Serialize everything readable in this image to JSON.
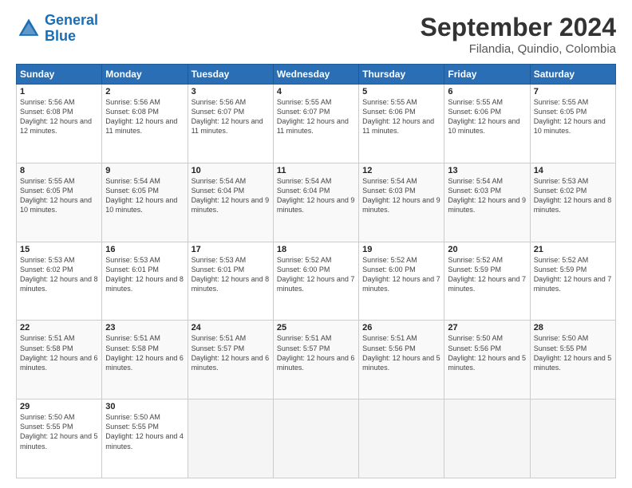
{
  "header": {
    "logo_general": "General",
    "logo_blue": "Blue",
    "month_title": "September 2024",
    "subtitle": "Filandia, Quindio, Colombia"
  },
  "calendar": {
    "days_of_week": [
      "Sunday",
      "Monday",
      "Tuesday",
      "Wednesday",
      "Thursday",
      "Friday",
      "Saturday"
    ],
    "weeks": [
      [
        {
          "day": "1",
          "sunrise": "5:56 AM",
          "sunset": "6:08 PM",
          "daylight": "12 hours and 12 minutes."
        },
        {
          "day": "2",
          "sunrise": "5:56 AM",
          "sunset": "6:08 PM",
          "daylight": "12 hours and 11 minutes."
        },
        {
          "day": "3",
          "sunrise": "5:56 AM",
          "sunset": "6:07 PM",
          "daylight": "12 hours and 11 minutes."
        },
        {
          "day": "4",
          "sunrise": "5:55 AM",
          "sunset": "6:07 PM",
          "daylight": "12 hours and 11 minutes."
        },
        {
          "day": "5",
          "sunrise": "5:55 AM",
          "sunset": "6:06 PM",
          "daylight": "12 hours and 11 minutes."
        },
        {
          "day": "6",
          "sunrise": "5:55 AM",
          "sunset": "6:06 PM",
          "daylight": "12 hours and 10 minutes."
        },
        {
          "day": "7",
          "sunrise": "5:55 AM",
          "sunset": "6:05 PM",
          "daylight": "12 hours and 10 minutes."
        }
      ],
      [
        {
          "day": "8",
          "sunrise": "5:55 AM",
          "sunset": "6:05 PM",
          "daylight": "12 hours and 10 minutes."
        },
        {
          "day": "9",
          "sunrise": "5:54 AM",
          "sunset": "6:05 PM",
          "daylight": "12 hours and 10 minutes."
        },
        {
          "day": "10",
          "sunrise": "5:54 AM",
          "sunset": "6:04 PM",
          "daylight": "12 hours and 9 minutes."
        },
        {
          "day": "11",
          "sunrise": "5:54 AM",
          "sunset": "6:04 PM",
          "daylight": "12 hours and 9 minutes."
        },
        {
          "day": "12",
          "sunrise": "5:54 AM",
          "sunset": "6:03 PM",
          "daylight": "12 hours and 9 minutes."
        },
        {
          "day": "13",
          "sunrise": "5:54 AM",
          "sunset": "6:03 PM",
          "daylight": "12 hours and 9 minutes."
        },
        {
          "day": "14",
          "sunrise": "5:53 AM",
          "sunset": "6:02 PM",
          "daylight": "12 hours and 8 minutes."
        }
      ],
      [
        {
          "day": "15",
          "sunrise": "5:53 AM",
          "sunset": "6:02 PM",
          "daylight": "12 hours and 8 minutes."
        },
        {
          "day": "16",
          "sunrise": "5:53 AM",
          "sunset": "6:01 PM",
          "daylight": "12 hours and 8 minutes."
        },
        {
          "day": "17",
          "sunrise": "5:53 AM",
          "sunset": "6:01 PM",
          "daylight": "12 hours and 8 minutes."
        },
        {
          "day": "18",
          "sunrise": "5:52 AM",
          "sunset": "6:00 PM",
          "daylight": "12 hours and 7 minutes."
        },
        {
          "day": "19",
          "sunrise": "5:52 AM",
          "sunset": "6:00 PM",
          "daylight": "12 hours and 7 minutes."
        },
        {
          "day": "20",
          "sunrise": "5:52 AM",
          "sunset": "5:59 PM",
          "daylight": "12 hours and 7 minutes."
        },
        {
          "day": "21",
          "sunrise": "5:52 AM",
          "sunset": "5:59 PM",
          "daylight": "12 hours and 7 minutes."
        }
      ],
      [
        {
          "day": "22",
          "sunrise": "5:51 AM",
          "sunset": "5:58 PM",
          "daylight": "12 hours and 6 minutes."
        },
        {
          "day": "23",
          "sunrise": "5:51 AM",
          "sunset": "5:58 PM",
          "daylight": "12 hours and 6 minutes."
        },
        {
          "day": "24",
          "sunrise": "5:51 AM",
          "sunset": "5:57 PM",
          "daylight": "12 hours and 6 minutes."
        },
        {
          "day": "25",
          "sunrise": "5:51 AM",
          "sunset": "5:57 PM",
          "daylight": "12 hours and 6 minutes."
        },
        {
          "day": "26",
          "sunrise": "5:51 AM",
          "sunset": "5:56 PM",
          "daylight": "12 hours and 5 minutes."
        },
        {
          "day": "27",
          "sunrise": "5:50 AM",
          "sunset": "5:56 PM",
          "daylight": "12 hours and 5 minutes."
        },
        {
          "day": "28",
          "sunrise": "5:50 AM",
          "sunset": "5:55 PM",
          "daylight": "12 hours and 5 minutes."
        }
      ],
      [
        {
          "day": "29",
          "sunrise": "5:50 AM",
          "sunset": "5:55 PM",
          "daylight": "12 hours and 5 minutes."
        },
        {
          "day": "30",
          "sunrise": "5:50 AM",
          "sunset": "5:55 PM",
          "daylight": "12 hours and 4 minutes."
        },
        null,
        null,
        null,
        null,
        null
      ]
    ]
  }
}
